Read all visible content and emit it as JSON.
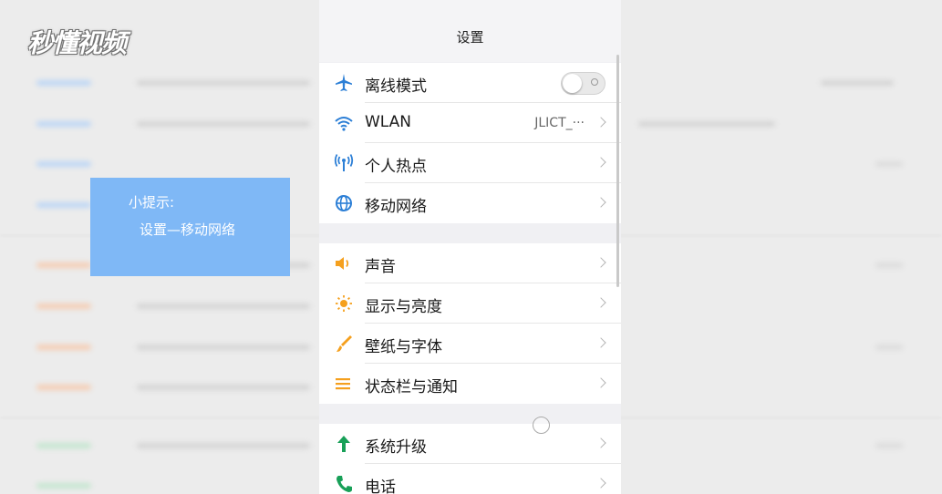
{
  "watermark": {
    "logo_text": "秒懂视频"
  },
  "tip": {
    "title": "小提示:",
    "body": "设置—移动网络"
  },
  "header": {
    "title": "设置"
  },
  "colors": {
    "blue": "#2c7fd6",
    "orange": "#f5a01e",
    "green": "#18a058",
    "tip_bg": "#7fb8f6"
  },
  "groups": [
    {
      "items": [
        {
          "icon": "airplane-icon",
          "label": "离线模式",
          "toggle": false
        },
        {
          "icon": "wifi-icon",
          "label": "WLAN",
          "value": "JLICT_···"
        },
        {
          "icon": "hotspot-icon",
          "label": "个人热点"
        },
        {
          "icon": "globe-icon",
          "label": "移动网络"
        }
      ]
    },
    {
      "items": [
        {
          "icon": "speaker-icon",
          "label": "声音"
        },
        {
          "icon": "brightness-icon",
          "label": "显示与亮度"
        },
        {
          "icon": "brush-icon",
          "label": "壁纸与字体"
        },
        {
          "icon": "statusbar-icon",
          "label": "状态栏与通知"
        }
      ]
    },
    {
      "items": [
        {
          "icon": "upgrade-arrow-icon",
          "label": "系统升级"
        },
        {
          "icon": "phone-icon",
          "label": "电话"
        }
      ]
    }
  ]
}
